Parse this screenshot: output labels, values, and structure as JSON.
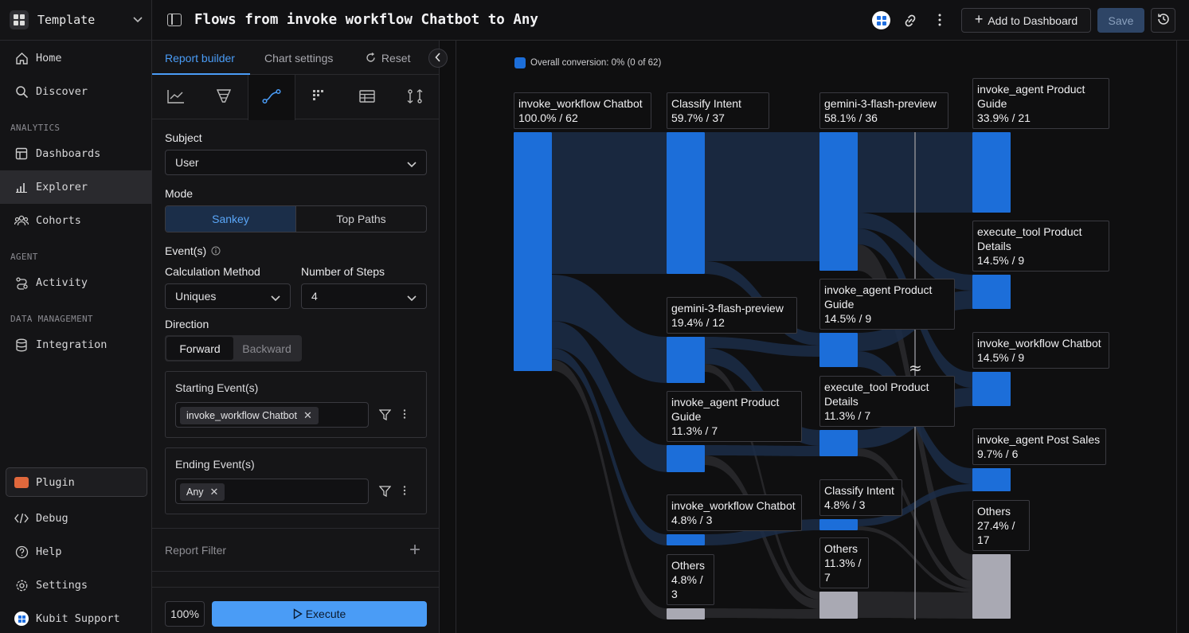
{
  "workspace": {
    "name": "Template"
  },
  "nav": {
    "home": "Home",
    "discover": "Discover",
    "section_analytics": "ANALYTICS",
    "dashboards": "Dashboards",
    "explorer": "Explorer",
    "cohorts": "Cohorts",
    "section_agent": "AGENT",
    "activity": "Activity",
    "section_data": "DATA MANAGEMENT",
    "integration": "Integration",
    "plugin": "Plugin",
    "debug": "Debug",
    "help": "Help",
    "settings": "Settings",
    "support": "Kubit Support"
  },
  "header": {
    "title": "Flows from invoke workflow Chatbot to Any",
    "add_to_dashboard": "Add to Dashboard",
    "save": "Save"
  },
  "builder": {
    "tabs": [
      "Report builder",
      "Chart settings",
      "Reset"
    ],
    "chart_types": [
      "line-chart-icon",
      "funnel-icon",
      "flow-icon",
      "grid-icon",
      "table-icon",
      "path-icon"
    ],
    "subject_label": "Subject",
    "subject_value": "User",
    "mode_label": "Mode",
    "mode_options": [
      "Sankey",
      "Top Paths"
    ],
    "events_label": "Event(s)",
    "calc_label": "Calculation Method",
    "calc_value": "Uniques",
    "steps_label": "Number of Steps",
    "steps_value": "4",
    "direction_label": "Direction",
    "direction_options": [
      "Forward",
      "Backward"
    ],
    "starting_label": "Starting Event(s)",
    "starting_chip": "invoke_workflow Chatbot",
    "ending_label": "Ending Event(s)",
    "ending_chip": "Any",
    "report_filter": "Report Filter",
    "zoom": "100%",
    "execute": "Execute"
  },
  "chart_data": {
    "type": "sankey",
    "overall_conversion": "Overall conversion: 0% (0 of 62)",
    "colors": {
      "node": "#1c6ed9",
      "others": "#a9a9b3",
      "link": "#1b2d48",
      "link_others": "#2a2a2e"
    },
    "steps": [
      [
        {
          "label": "invoke_workflow Chatbot",
          "stats": "100.0% / 62",
          "value": 62
        }
      ],
      [
        {
          "label": "Classify Intent",
          "stats": "59.7% / 37",
          "value": 37
        },
        {
          "label": "gemini-3-flash-preview",
          "stats": "19.4% / 12",
          "value": 12
        },
        {
          "label": "invoke_agent Product Guide",
          "stats": "11.3% / 7",
          "value": 7
        },
        {
          "label": "invoke_workflow Chatbot",
          "stats": "4.8% / 3",
          "value": 3
        },
        {
          "label": "Others",
          "stats": "4.8% / 3",
          "value": 3,
          "others": true
        }
      ],
      [
        {
          "label": "gemini-3-flash-preview",
          "stats": "58.1% / 36",
          "value": 36
        },
        {
          "label": "invoke_agent Product Guide",
          "stats": "14.5% / 9",
          "value": 9
        },
        {
          "label": "execute_tool Product Details",
          "stats": "11.3% / 7",
          "value": 7
        },
        {
          "label": "Classify Intent",
          "stats": "4.8% / 3",
          "value": 3
        },
        {
          "label": "Others",
          "stats": "11.3% / 7",
          "value": 7,
          "others": true
        }
      ],
      [
        {
          "label": "invoke_agent Product Guide",
          "stats": "33.9% / 21",
          "value": 21
        },
        {
          "label": "execute_tool Product Details",
          "stats": "14.5% / 9",
          "value": 9
        },
        {
          "label": "invoke_workflow Chatbot",
          "stats": "14.5% / 9",
          "value": 9
        },
        {
          "label": "invoke_agent Post Sales",
          "stats": "9.7% / 6",
          "value": 6
        },
        {
          "label": "Others",
          "stats": "27.4% / 17",
          "value": 17,
          "others": true
        }
      ]
    ]
  }
}
